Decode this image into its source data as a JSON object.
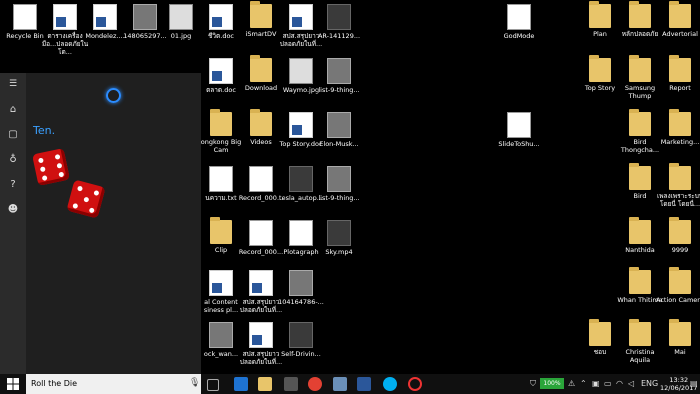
{
  "desktop": {
    "icons": [
      {
        "label": "Recycle Bin",
        "kind": "generic"
      },
      {
        "label": "ตารางเครื่องมือ...ปลอดภัยในโต...",
        "kind": "doc"
      },
      {
        "label": "Mondelez....",
        "kind": "doc"
      },
      {
        "label": "1480652​97...",
        "kind": "photo"
      },
      {
        "label": "01.jpg",
        "kind": "img"
      },
      {
        "label": "ชีวิต.doc",
        "kind": "doc"
      },
      {
        "label": "iSmartDV",
        "kind": "folder"
      },
      {
        "label": "สปส.สรุปยาวปลอดภัยในที่...",
        "kind": "doc"
      },
      {
        "label": "AR-141129...",
        "kind": "video"
      },
      {
        "label": "GodMode",
        "kind": "generic"
      },
      {
        "label": "Plan",
        "kind": "folder"
      },
      {
        "label": "หลักปลอดภัย",
        "kind": "folder"
      },
      {
        "label": "Advertorial",
        "kind": "folder"
      },
      {
        "label": "ตลาด.doc",
        "kind": "doc"
      },
      {
        "label": "Download",
        "kind": "folder"
      },
      {
        "label": "Waymo.jpg",
        "kind": "img"
      },
      {
        "label": "list-9-thing...",
        "kind": "photo"
      },
      {
        "label": "Top Story",
        "kind": "folder"
      },
      {
        "label": "Samsung Thump",
        "kind": "folder"
      },
      {
        "label": "Report",
        "kind": "folder"
      },
      {
        "label": "ongkong Big Cam",
        "kind": "folder"
      },
      {
        "label": "Videos",
        "kind": "folder"
      },
      {
        "label": "Top Story.doc",
        "kind": "doc"
      },
      {
        "label": "Elon-Musk...",
        "kind": "photo"
      },
      {
        "label": "SlideToShu...",
        "kind": "generic"
      },
      {
        "label": "Bird Thongcha...",
        "kind": "folder"
      },
      {
        "label": "Marketing...",
        "kind": "folder"
      },
      {
        "label": "นความ.txt",
        "kind": "generic"
      },
      {
        "label": "Record_000...",
        "kind": "generic"
      },
      {
        "label": "tesla_autop...",
        "kind": "video"
      },
      {
        "label": "list-9-thing...",
        "kind": "photo"
      },
      {
        "label": "Bird",
        "kind": "folder"
      },
      {
        "label": "เพลงเพราะระบบโดยนี่ โดยนี่...",
        "kind": "folder"
      },
      {
        "label": "Clip",
        "kind": "folder"
      },
      {
        "label": "Record_000...",
        "kind": "generic"
      },
      {
        "label": "Plotagraph",
        "kind": "generic"
      },
      {
        "label": "Sky.mp4",
        "kind": "video"
      },
      {
        "label": "Nanthida",
        "kind": "folder"
      },
      {
        "label": "9999",
        "kind": "folder"
      },
      {
        "label": "al Content siness pl...",
        "kind": "doc"
      },
      {
        "label": "สปส.สรุปยาวปลอดภัยในที่...",
        "kind": "doc"
      },
      {
        "label": "104164786-...",
        "kind": "photo"
      },
      {
        "label": "Whan Thitima",
        "kind": "folder"
      },
      {
        "label": "Action Camera",
        "kind": "folder"
      },
      {
        "label": "ock_wan...",
        "kind": "photo"
      },
      {
        "label": "สปส.สรุปยาวปลอดภัยในที่...",
        "kind": "doc"
      },
      {
        "label": "Self-Drivin...",
        "kind": "video"
      },
      {
        "label": "ชอบ",
        "kind": "folder"
      },
      {
        "label": "Christina Aquila",
        "kind": "folder"
      },
      {
        "label": "Mai",
        "kind": "folder"
      }
    ]
  },
  "cortana": {
    "answer": "Ten.",
    "rail": [
      "home-icon",
      "notebook-icon",
      "lightbulb-icon",
      "help-icon",
      "feedback-icon"
    ]
  },
  "taskbar": {
    "search_text": "Roll the Die",
    "battery": "100%",
    "language": "ENG",
    "time": "13:32",
    "date": "12/06/2017"
  }
}
